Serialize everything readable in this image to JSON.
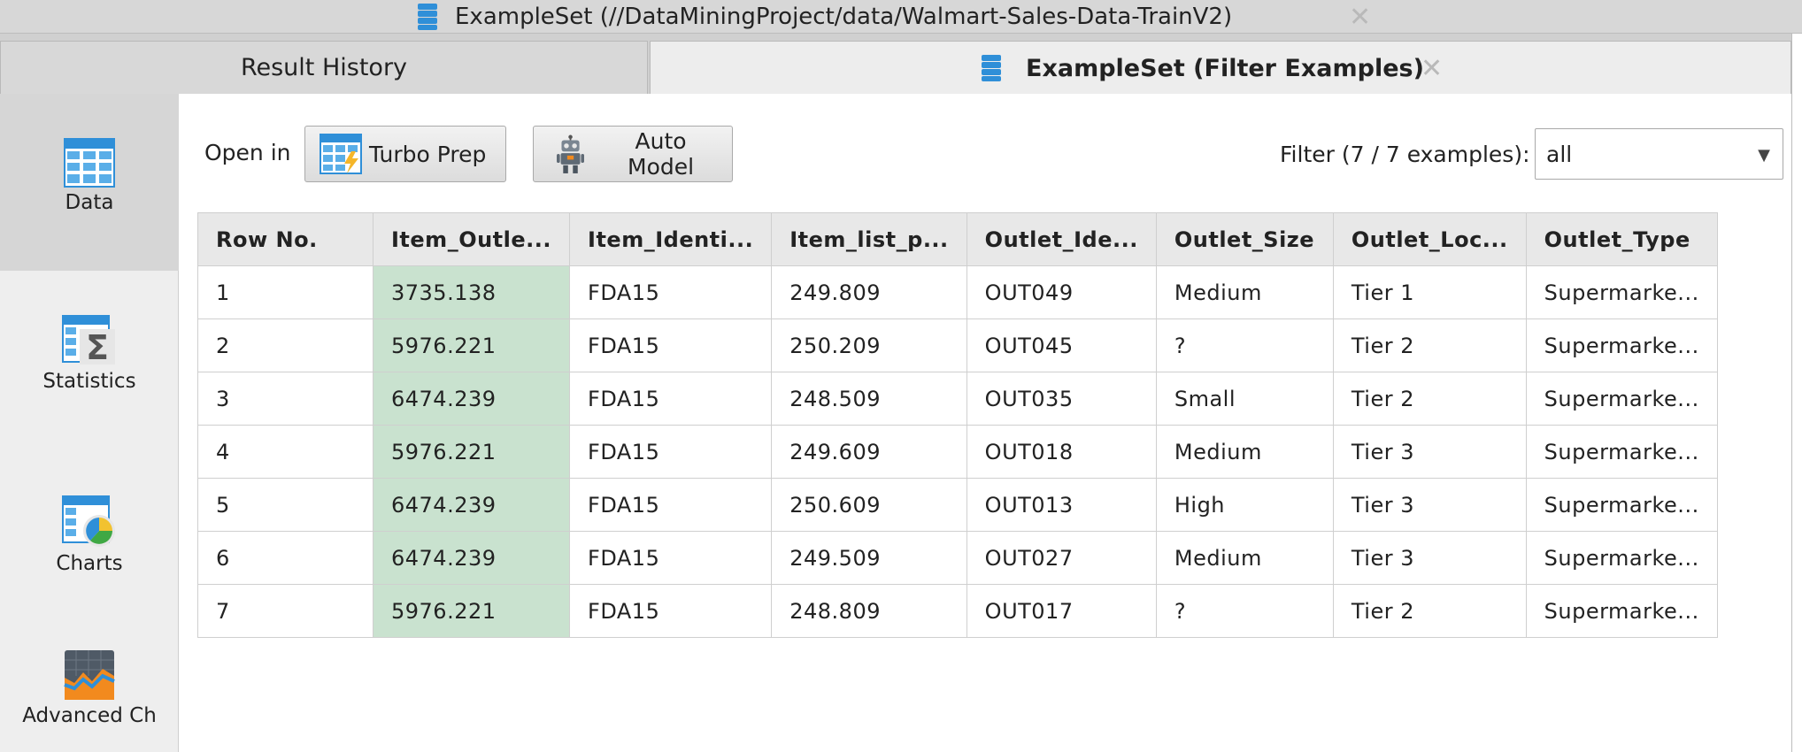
{
  "window_tab": {
    "title": "ExampleSet (//DataMiningProject/data/Walmart-Sales-Data-TrainV2)",
    "close": "✕"
  },
  "tabs": {
    "history": "Result History",
    "active": "ExampleSet (Filter Examples)",
    "close": "✕"
  },
  "sidebar": {
    "items": [
      {
        "label": "Data"
      },
      {
        "label": "Statistics"
      },
      {
        "label": "Charts"
      },
      {
        "label": "Advanced Ch"
      }
    ]
  },
  "toolbar": {
    "open_in": "Open in",
    "turbo_prep": "Turbo Prep",
    "auto_model": "Auto Model",
    "filter_label": "Filter (7 / 7 examples):",
    "filter_value": "all"
  },
  "table": {
    "headers": [
      "Row No.",
      "Item_Outle...",
      "Item_Identi...",
      "Item_list_p...",
      "Outlet_Ide...",
      "Outlet_Size",
      "Outlet_Loc...",
      "Outlet_Type"
    ],
    "rows": [
      [
        "1",
        "3735.138",
        "FDA15",
        "249.809",
        "OUT049",
        "Medium",
        "Tier 1",
        "Supermarke..."
      ],
      [
        "2",
        "5976.221",
        "FDA15",
        "250.209",
        "OUT045",
        "?",
        "Tier 2",
        "Supermarke..."
      ],
      [
        "3",
        "6474.239",
        "FDA15",
        "248.509",
        "OUT035",
        "Small",
        "Tier 2",
        "Supermarke..."
      ],
      [
        "4",
        "5976.221",
        "FDA15",
        "249.609",
        "OUT018",
        "Medium",
        "Tier 3",
        "Supermarke..."
      ],
      [
        "5",
        "6474.239",
        "FDA15",
        "250.609",
        "OUT013",
        "High",
        "Tier 3",
        "Supermarke..."
      ],
      [
        "6",
        "6474.239",
        "FDA15",
        "249.509",
        "OUT027",
        "Medium",
        "Tier 3",
        "Supermarke..."
      ],
      [
        "7",
        "5976.221",
        "FDA15",
        "248.809",
        "OUT017",
        "?",
        "Tier 2",
        "Supermarke..."
      ]
    ]
  },
  "colors": {
    "highlight_column": "#c9e2cf",
    "accent_blue": "#2f8fd8"
  }
}
